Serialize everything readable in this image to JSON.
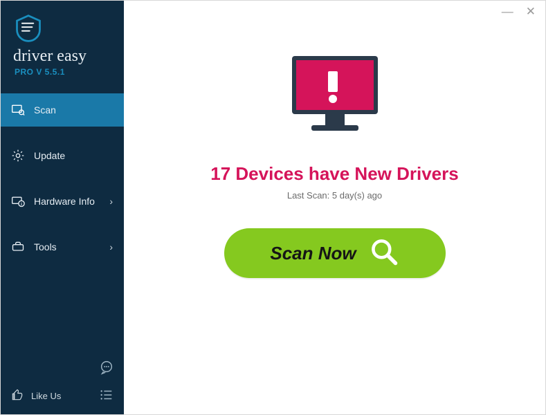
{
  "brand": {
    "name": "driver easy",
    "version": "PRO V 5.5.1"
  },
  "sidebar": {
    "items": [
      {
        "label": "Scan",
        "icon": "scan-icon",
        "active": true,
        "expandable": false
      },
      {
        "label": "Update",
        "icon": "gear-icon",
        "active": false,
        "expandable": false
      },
      {
        "label": "Hardware Info",
        "icon": "hardware-info-icon",
        "active": false,
        "expandable": true
      },
      {
        "label": "Tools",
        "icon": "tools-icon",
        "active": false,
        "expandable": true
      }
    ],
    "footer": {
      "like_label": "Like Us"
    }
  },
  "main": {
    "headline": "17 Devices have New Drivers",
    "last_scan": "Last Scan: 5 day(s) ago",
    "scan_button": "Scan Now"
  },
  "window": {
    "minimize": "—",
    "close": "✕"
  },
  "colors": {
    "sidebar_bg": "#0e2b41",
    "sidebar_active": "#1a79a8",
    "accent_pink": "#d5145a",
    "accent_green": "#85c91f"
  }
}
